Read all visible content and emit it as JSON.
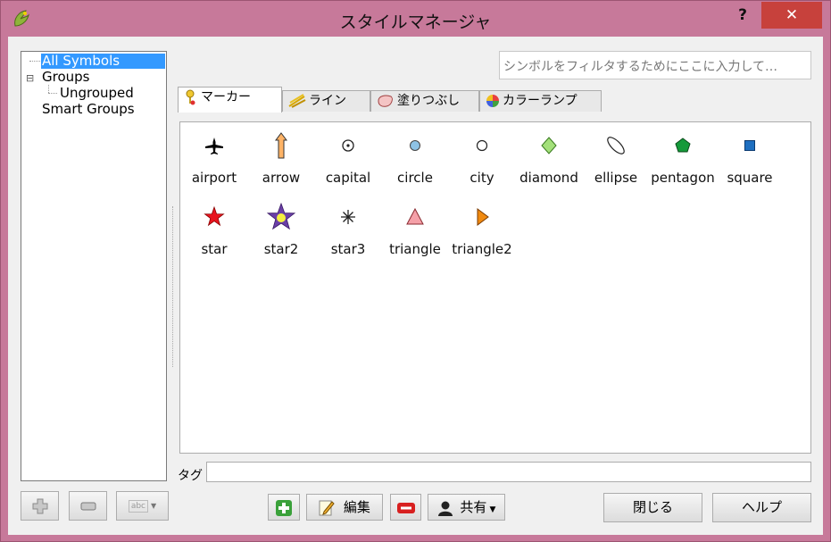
{
  "window": {
    "title": "スタイルマネージャ",
    "help_label": "?",
    "close_label": "✕"
  },
  "tree": {
    "items": [
      {
        "label": "All Symbols"
      },
      {
        "label": "Groups"
      },
      {
        "label": "Ungrouped"
      },
      {
        "label": "Smart Groups"
      }
    ],
    "expander": "⊟"
  },
  "search": {
    "placeholder": "シンボルをフィルタするためにここに入力して…"
  },
  "tabs": [
    {
      "label": "マーカー"
    },
    {
      "label": "ライン"
    },
    {
      "label": "塗りつぶし"
    },
    {
      "label": "カラーランプ"
    }
  ],
  "symbols": [
    {
      "label": "airport",
      "icon": "airport-icon"
    },
    {
      "label": "arrow",
      "icon": "arrow-icon"
    },
    {
      "label": "capital",
      "icon": "capital-icon"
    },
    {
      "label": "circle",
      "icon": "circle-icon"
    },
    {
      "label": "city",
      "icon": "city-icon"
    },
    {
      "label": "diamond",
      "icon": "diamond-icon"
    },
    {
      "label": "ellipse",
      "icon": "ellipse-icon"
    },
    {
      "label": "pentagon",
      "icon": "pentagon-icon"
    },
    {
      "label": "square",
      "icon": "square-icon"
    },
    {
      "label": "star",
      "icon": "star-icon"
    },
    {
      "label": "star2",
      "icon": "star2-icon"
    },
    {
      "label": "star3",
      "icon": "star3-icon"
    },
    {
      "label": "triangle",
      "icon": "triangle-icon"
    },
    {
      "label": "triangle2",
      "icon": "triangle2-icon"
    }
  ],
  "tag": {
    "label": "タグ"
  },
  "buttons": {
    "edit": "編集",
    "share": "共有",
    "close": "閉じる",
    "help": "ヘルプ",
    "rename_icon_text": "abc"
  },
  "colors": {
    "titlebar": "#c7799a",
    "close_button": "#c7413c",
    "selection": "#3399ff"
  }
}
